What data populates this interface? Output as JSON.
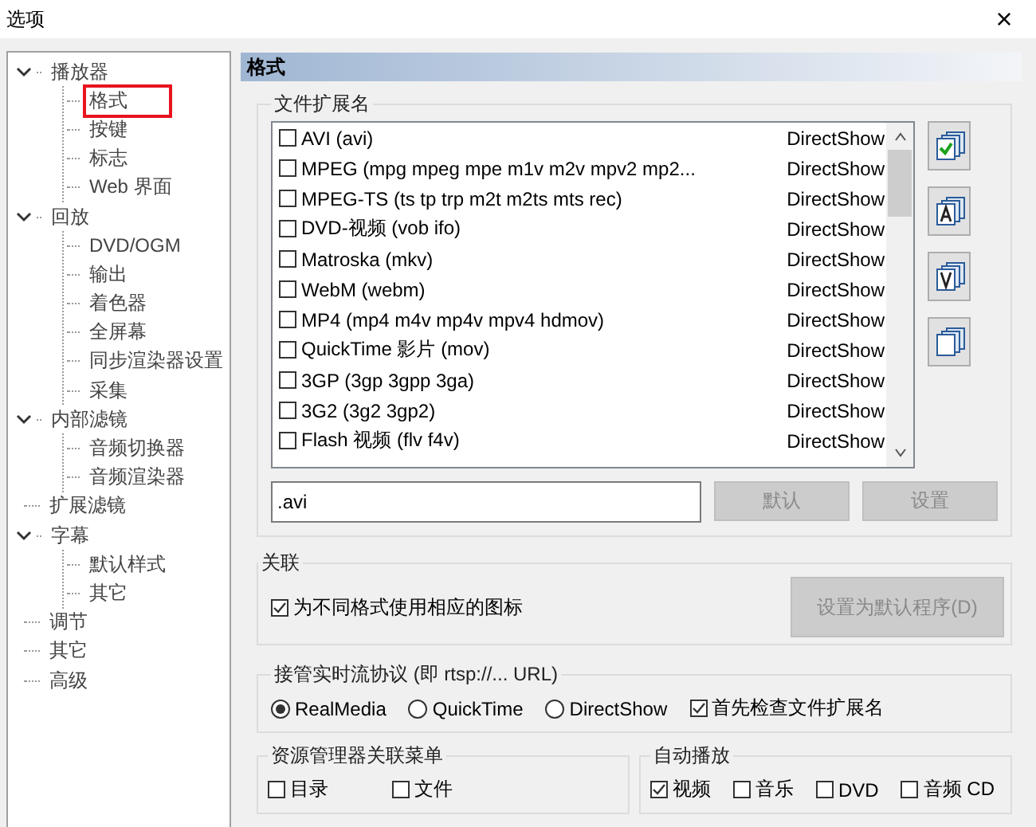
{
  "window": {
    "title": "选项",
    "close": "×"
  },
  "tree": [
    {
      "label": "播放器",
      "expanded": true,
      "selected": false,
      "children": [
        {
          "label": "格式",
          "selected": true
        },
        {
          "label": "按键",
          "selected": false
        },
        {
          "label": "标志",
          "selected": false
        },
        {
          "label": "Web 界面",
          "selected": false
        }
      ]
    },
    {
      "label": "回放",
      "expanded": true,
      "selected": false,
      "children": [
        {
          "label": "DVD/OGM",
          "selected": false
        },
        {
          "label": "输出",
          "selected": false
        },
        {
          "label": "着色器",
          "selected": false
        },
        {
          "label": "全屏幕",
          "selected": false
        },
        {
          "label": "同步渲染器设置",
          "selected": false
        },
        {
          "label": "采集",
          "selected": false
        }
      ]
    },
    {
      "label": "内部滤镜",
      "expanded": true,
      "selected": false,
      "children": [
        {
          "label": "音频切换器",
          "selected": false
        },
        {
          "label": "音频渲染器",
          "selected": false
        }
      ]
    },
    {
      "label": "扩展滤镜",
      "expanded": false,
      "selected": false
    },
    {
      "label": "字幕",
      "expanded": true,
      "selected": false,
      "children": [
        {
          "label": "默认样式",
          "selected": false
        },
        {
          "label": "其它",
          "selected": false
        }
      ]
    },
    {
      "label": "调节",
      "expanded": false,
      "selected": false
    },
    {
      "label": "其它",
      "expanded": false,
      "selected": false
    },
    {
      "label": "高级",
      "expanded": false,
      "selected": false
    }
  ],
  "page_title": "格式",
  "extensions": {
    "title": "文件扩展名",
    "rows": [
      {
        "name": "AVI (avi)",
        "handler": "DirectShow",
        "checked": false
      },
      {
        "name": "MPEG (mpg mpeg mpe m1v m2v mpv2 mp2...",
        "handler": "DirectShow",
        "checked": false
      },
      {
        "name": "MPEG-TS (ts tp trp m2t m2ts mts rec)",
        "handler": "DirectShow",
        "checked": false
      },
      {
        "name": "DVD-视频 (vob ifo)",
        "handler": "DirectShow",
        "checked": false
      },
      {
        "name": "Matroska (mkv)",
        "handler": "DirectShow",
        "checked": false
      },
      {
        "name": "WebM (webm)",
        "handler": "DirectShow",
        "checked": false
      },
      {
        "name": "MP4 (mp4 m4v mp4v mpv4 hdmov)",
        "handler": "DirectShow",
        "checked": false
      },
      {
        "name": "QuickTime 影片 (mov)",
        "handler": "DirectShow",
        "checked": false
      },
      {
        "name": "3GP (3gp 3gpp 3ga)",
        "handler": "DirectShow",
        "checked": false
      },
      {
        "name": "3G2 (3g2 3gp2)",
        "handler": "DirectShow",
        "checked": false
      },
      {
        "name": "Flash 视频 (flv f4v)",
        "handler": "DirectShow",
        "checked": false
      }
    ],
    "value": ".avi",
    "buttons": [
      {
        "label": "默认",
        "disabled": true
      },
      {
        "label": "设置",
        "disabled": true
      }
    ],
    "side_buttons": [
      {
        "kind": "check"
      },
      {
        "kind": "audio"
      },
      {
        "kind": "video"
      },
      {
        "kind": "none"
      }
    ]
  },
  "association": {
    "title": "关联",
    "option": {
      "label": "为不同格式使用相应的图标",
      "checked": true
    },
    "button": {
      "label": "设置为默认程序(D)",
      "disabled": true
    }
  },
  "streaming": {
    "title": "接管实时流协议 (即 rtsp://... URL)",
    "radios": [
      {
        "label": "RealMedia",
        "selected": true
      },
      {
        "label": "QuickTime",
        "selected": false
      },
      {
        "label": "DirectShow",
        "selected": false
      }
    ],
    "option": {
      "label": "首先检查文件扩展名",
      "checked": true
    }
  },
  "explorer_menu": {
    "title": "资源管理器关联菜单",
    "options": [
      {
        "label": "目录",
        "checked": false
      },
      {
        "label": "文件",
        "checked": false
      }
    ]
  },
  "autoplay": {
    "title": "自动播放",
    "options": [
      {
        "label": "视频",
        "checked": true
      },
      {
        "label": "音乐",
        "checked": false
      },
      {
        "label": "DVD",
        "checked": false
      },
      {
        "label": "音频 CD",
        "checked": false
      }
    ]
  }
}
